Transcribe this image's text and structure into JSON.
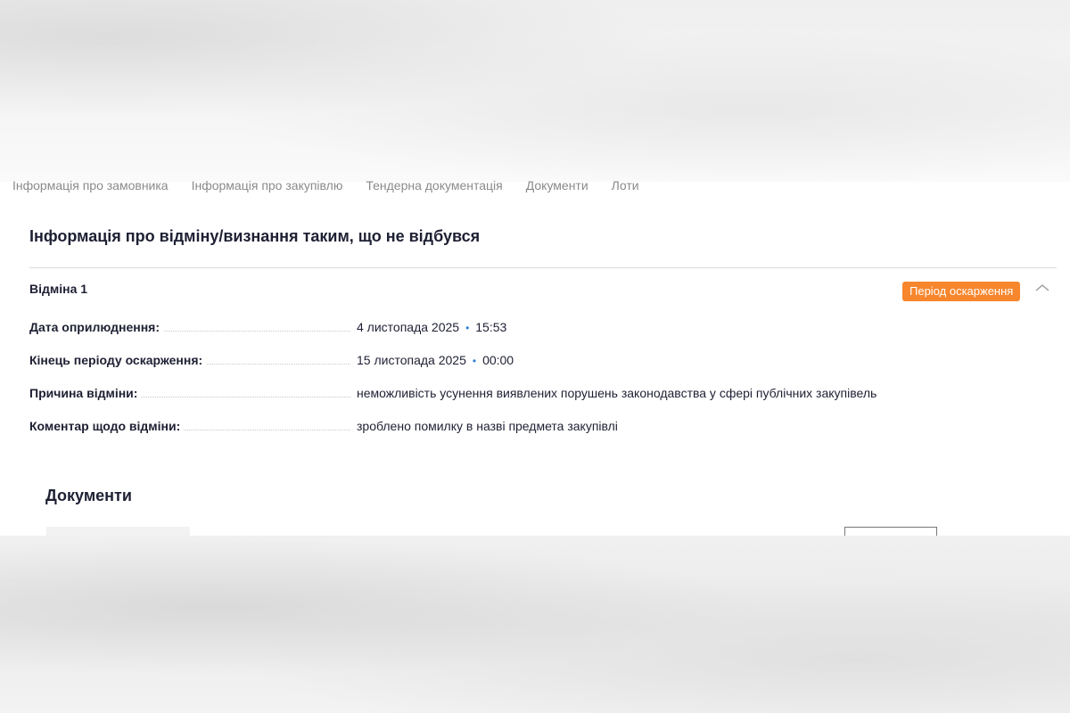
{
  "nav": {
    "items": [
      "Інформація про замовника",
      "Інформація про закупівлю",
      "Тендерна документація",
      "Документи",
      "Лоти"
    ]
  },
  "section": {
    "title": "Інформація про відміну/визнання таким, що не відбувся"
  },
  "cancellation": {
    "title": "Відміна 1",
    "badge": "Період оскарження",
    "colors": {
      "badge": "#f7862d",
      "separator_dot": "#2f7ed8"
    },
    "fields": [
      {
        "label": "Дата оприлюднення:",
        "date": "4 листопада 2025",
        "time": "15:53"
      },
      {
        "label": "Кінець періоду оскарження:",
        "date": "15 листопада 2025",
        "time": "00:00"
      },
      {
        "label": "Причина відміни:",
        "value": "неможливість усунення виявлених порушень законодавства у сфері публічних закупівель"
      },
      {
        "label": "Коментар щодо відміни:",
        "value": "зроблено помилку в назві предмета закупівлі"
      }
    ]
  },
  "documents": {
    "title": "Документи"
  },
  "icons": {
    "collapse": "chevron-up-icon"
  }
}
